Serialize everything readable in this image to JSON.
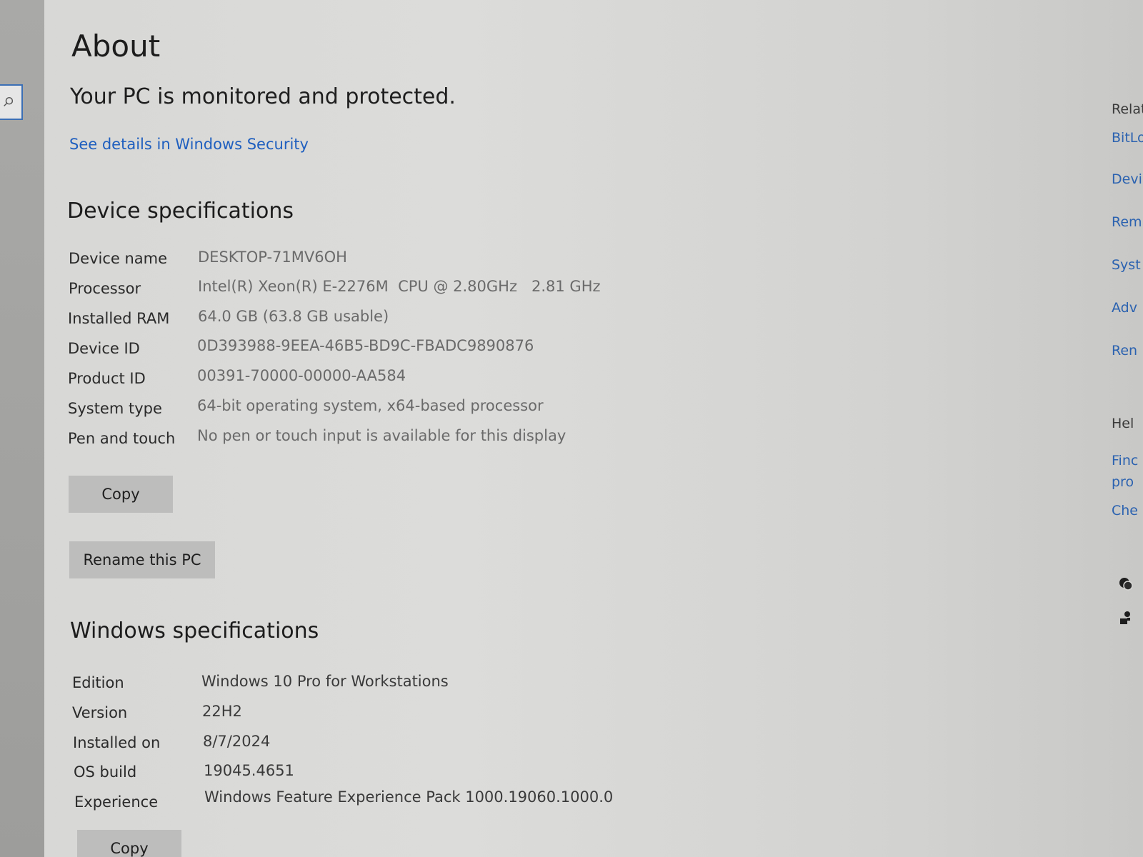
{
  "page": {
    "title": "About",
    "protection_status": "Your PC is monitored and protected.",
    "security_link": "See details in Windows Security"
  },
  "device_specs": {
    "title": "Device specifications",
    "rows": [
      {
        "label": "Device name",
        "value": "DESKTOP-71MV6OH"
      },
      {
        "label": "Processor",
        "value": "Intel(R) Xeon(R) E-2276M  CPU @ 2.80GHz   2.81 GHz"
      },
      {
        "label": "Installed RAM",
        "value": "64.0 GB (63.8 GB usable)"
      },
      {
        "label": "Device ID",
        "value": "0D393988-9EEA-46B5-BD9C-FBADC9890876"
      },
      {
        "label": "Product ID",
        "value": "00391-70000-00000-AA584"
      },
      {
        "label": "System type",
        "value": "64-bit operating system, x64-based processor"
      },
      {
        "label": "Pen and touch",
        "value": "No pen or touch input is available for this display"
      }
    ],
    "copy_label": "Copy",
    "rename_label": "Rename this PC"
  },
  "windows_specs": {
    "title": "Windows specifications",
    "rows": [
      {
        "label": "Edition",
        "value": "Windows 10 Pro for Workstations"
      },
      {
        "label": "Version",
        "value": "22H2"
      },
      {
        "label": "Installed on",
        "value": "8/7/2024"
      },
      {
        "label": "OS build",
        "value": "19045.4651"
      },
      {
        "label": "Experience",
        "value": "Windows Feature Experience Pack 1000.19060.1000.0"
      }
    ],
    "copy_label": "Copy"
  },
  "right_panel": {
    "related": "Relat",
    "links": [
      "BitLo",
      "Devi",
      "Rem",
      "Syst",
      "Adv",
      "Ren"
    ],
    "help": "Hel",
    "help_links": [
      "Finc",
      "pro",
      "Che"
    ]
  },
  "colors": {
    "link": "#1f5fbf",
    "button": "#bdbdbc"
  }
}
